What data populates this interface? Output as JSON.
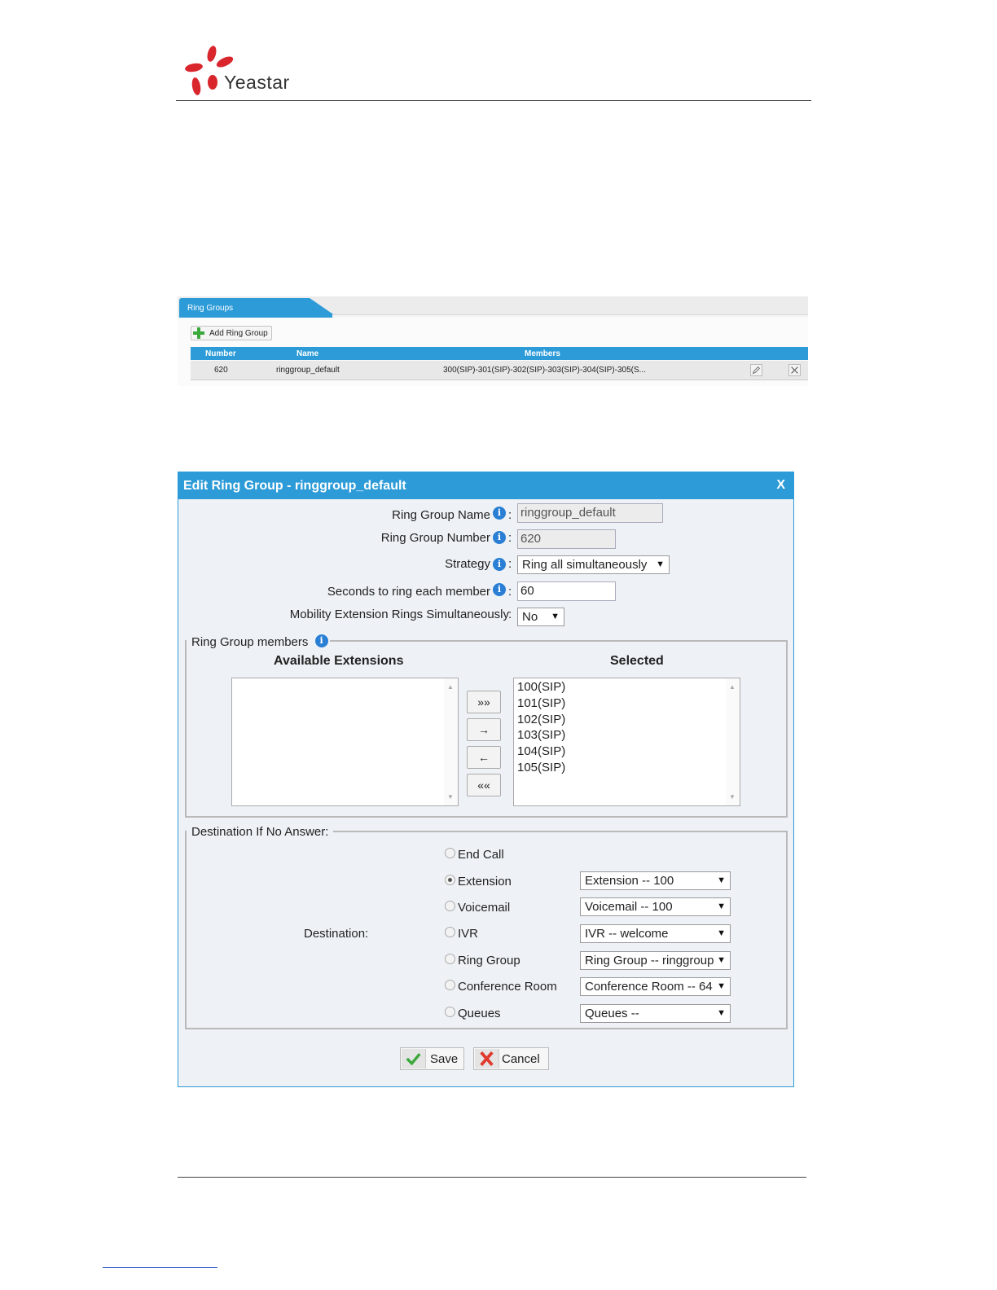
{
  "brand": {
    "name": "Yeastar"
  },
  "ring_groups": {
    "tab_title": "Ring Groups",
    "add_button": "Add Ring Group",
    "columns": [
      "Number",
      "Name",
      "Members"
    ],
    "rows": [
      {
        "number": "620",
        "name": "ringgroup_default",
        "members": "300(SIP)-301(SIP)-302(SIP)-303(SIP)-304(SIP)-305(S..."
      }
    ]
  },
  "dialog": {
    "title": "Edit Ring Group - ringgroup_default",
    "close": "X",
    "fields": {
      "name_label": "Ring Group Name",
      "name_value": "ringgroup_default",
      "number_label": "Ring Group Number",
      "number_value": "620",
      "strategy_label": "Strategy",
      "strategy_value": "Ring all simultaneously",
      "seconds_label": "Seconds to ring each member",
      "seconds_value": "60",
      "mobility_label": "Mobility Extension Rings Simultaneously",
      "mobility_value": "No"
    },
    "members": {
      "legend": "Ring Group members",
      "available_title": "Available Extensions",
      "selected_title": "Selected",
      "available": [],
      "selected": [
        "100(SIP)",
        "101(SIP)",
        "102(SIP)",
        "103(SIP)",
        "104(SIP)",
        "105(SIP)"
      ],
      "buttons": [
        "»»",
        "→",
        "←",
        "««"
      ]
    },
    "destination": {
      "legend": "Destination If No Answer",
      "label": "Destination",
      "options": [
        {
          "label": "End Call",
          "selected": false,
          "select": null
        },
        {
          "label": "Extension",
          "selected": true,
          "select": "Extension -- 100"
        },
        {
          "label": "Voicemail",
          "selected": false,
          "select": "Voicemail -- 100"
        },
        {
          "label": "IVR",
          "selected": false,
          "select": "IVR -- welcome"
        },
        {
          "label": "Ring Group",
          "selected": false,
          "select": "Ring Group -- ringgroup"
        },
        {
          "label": "Conference Room",
          "selected": false,
          "select": "Conference Room -- 64"
        },
        {
          "label": "Queues",
          "selected": false,
          "select": "Queues --"
        }
      ]
    },
    "save_label": "Save",
    "cancel_label": "Cancel"
  },
  "colors": {
    "accent": "#2c9bd8",
    "brand_red": "#d9262c",
    "dialog_bg": "#eef2f6"
  }
}
